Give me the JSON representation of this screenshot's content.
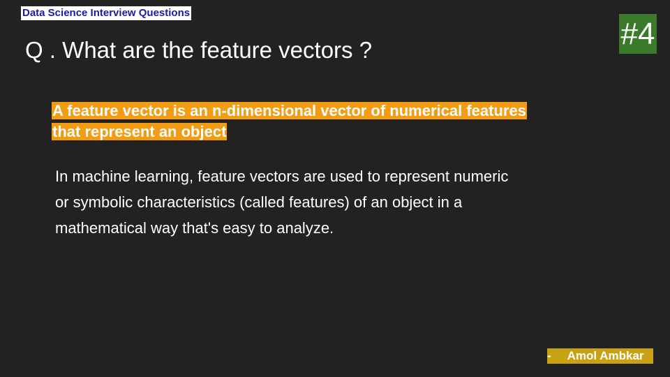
{
  "slide": {
    "series_label": "Data Science Interview Questions",
    "number": "#4",
    "question": "Q . What are the feature vectors ?",
    "highlight_lines": [
      "A feature vector is an n-dimensional vector of numerical features",
      "that represent an object"
    ],
    "explanation_lines": [
      "In machine learning, feature vectors are used to represent numeric",
      "or symbolic characteristics (called features) of an object in a",
      "mathematical way that's easy to analyze."
    ],
    "author": "-     Amol Ambkar"
  },
  "colors": {
    "background": "#222222",
    "badge_green": "#3a7a2a",
    "highlight_orange": "#f39c12",
    "author_gold": "#c9a213",
    "series_blue": "#1a1aa6"
  }
}
